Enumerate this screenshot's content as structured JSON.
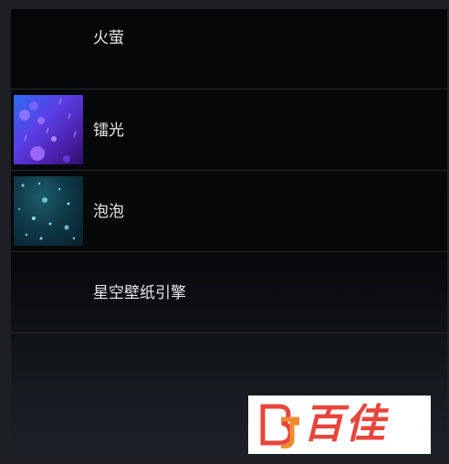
{
  "wallpaper_list": {
    "items": [
      {
        "label": "火萤",
        "thumbnail": "none"
      },
      {
        "label": "镭光",
        "thumbnail": "purple-light-particles"
      },
      {
        "label": "泡泡",
        "thumbnail": "teal-bubbles"
      },
      {
        "label": "星空壁纸引擎",
        "thumbnail": "none"
      }
    ]
  },
  "watermark": {
    "text": "百佳",
    "logo": "BJ-logo",
    "color": "#e8453c"
  }
}
